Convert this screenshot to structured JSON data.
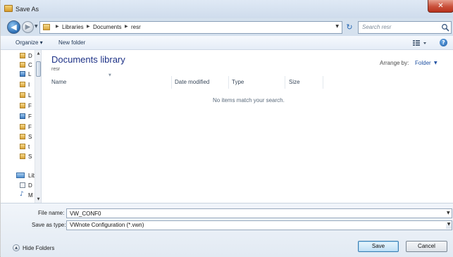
{
  "window": {
    "title": "Save As",
    "close_glyph": "✕"
  },
  "nav": {
    "back_glyph": "◀",
    "forward_glyph": "▶",
    "refresh_glyph": "↻"
  },
  "address": {
    "crumbs": [
      "Libraries",
      "Documents",
      "resr"
    ]
  },
  "search": {
    "placeholder": "Search resr"
  },
  "toolbar": {
    "organize_label": "Organize ▾",
    "new_folder_label": "New folder",
    "help_glyph": "?"
  },
  "nav_pane": {
    "items": [
      {
        "label": "D",
        "icon": "folder-icon"
      },
      {
        "label": "C",
        "icon": "folder-icon"
      },
      {
        "label": "L",
        "icon": "computer-icon"
      },
      {
        "label": "I",
        "icon": "folder-icon"
      },
      {
        "label": "L",
        "icon": "folder-icon"
      },
      {
        "label": "F",
        "icon": "folder-icon"
      },
      {
        "label": "F",
        "icon": "computer-icon"
      },
      {
        "label": "F",
        "icon": "folder-icon"
      },
      {
        "label": "S",
        "icon": "folder-icon"
      },
      {
        "label": "t",
        "icon": "folder-icon"
      },
      {
        "label": "S",
        "icon": "folder-icon"
      },
      {
        "label": "Lib",
        "icon": "library-icon"
      },
      {
        "label": "D",
        "icon": "document-icon"
      },
      {
        "label": "M",
        "icon": "music-icon"
      }
    ]
  },
  "library": {
    "title": "Documents library",
    "subtitle": "resr",
    "arrange_label": "Arrange by:",
    "arrange_value": "Folder"
  },
  "columns": [
    "Name",
    "Date modified",
    "Type",
    "Size"
  ],
  "empty_message": "No items match your search.",
  "form": {
    "file_name_label": "File name:",
    "file_name_value": "VW_CONF0",
    "save_type_label": "Save as type:",
    "save_type_value": "VWnote Configuration  (*.vwn)"
  },
  "footer": {
    "hide_folders_label": "Hide Folders",
    "save_label": "Save",
    "cancel_label": "Cancel"
  }
}
